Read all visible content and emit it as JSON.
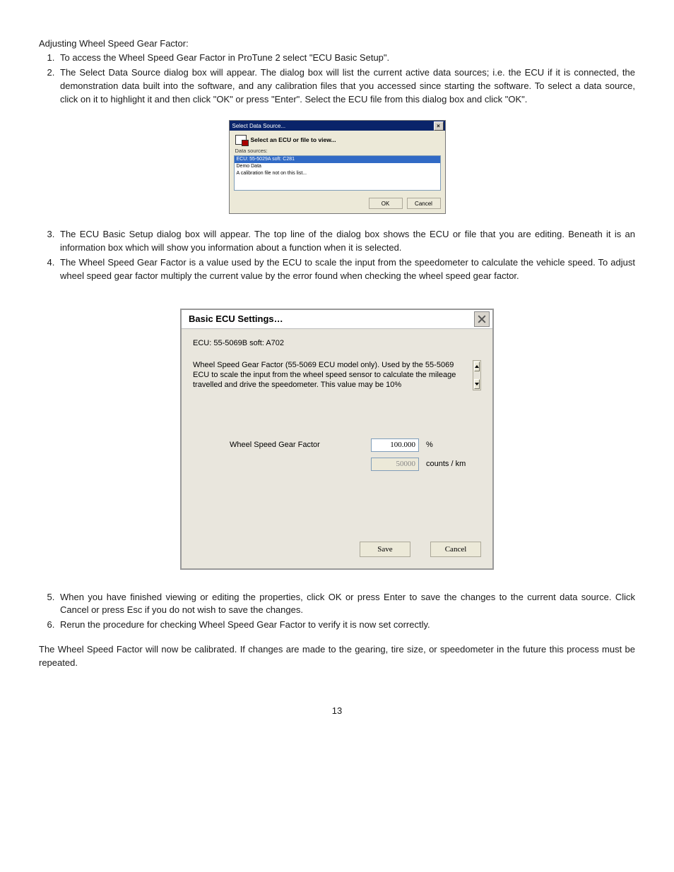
{
  "heading": "Adjusting Wheel Speed Gear Factor:",
  "steps_a": [
    "To access the Wheel Speed Gear Factor in ProTune 2 select \"ECU Basic Setup\".",
    "The Select Data Source dialog box will appear. The dialog box will list the current active data sources; i.e. the ECU if it is connected, the demonstration data built into the software, and any calibration files that you accessed since starting the software. To select a data source, click on it to highlight it and then click \"OK\" or press \"Enter\". Select the ECU file from this dialog box and click \"OK\"."
  ],
  "dlg1": {
    "peek": "",
    "title": "Select Data Source...",
    "prompt": "Select an ECU or file to view...",
    "list_label": "Data sources:",
    "items": [
      "ECU: 55-5029A soft: C281",
      "Demo Data",
      "A calibration file not on this list..."
    ],
    "ok": "OK",
    "cancel": "Cancel"
  },
  "steps_b": [
    "The ECU Basic Setup dialog box will appear. The top line of the dialog box shows the ECU or file that you are editing. Beneath it is an information box which will show you information about a function when it is selected.",
    "The Wheel Speed Gear Factor is a value used by the ECU to scale the input from the speedometer to calculate the vehicle speed. To adjust wheel speed gear factor multiply the current value by the error found when checking the wheel speed gear factor."
  ],
  "dlg2": {
    "title": "Basic ECU Settings…",
    "ecu_line": "ECU: 55-5069B soft: A702",
    "desc": "Wheel Speed Gear Factor (55-5069 ECU model only). Used by the 55-5069 ECU to scale the input from the wheel speed sensor to calculate the mileage travelled and drive the speedometer. This value may be 10%",
    "field_label": "Wheel Speed Gear Factor",
    "val1": "100.000",
    "unit1": "%",
    "val2": "50000",
    "unit2": "counts / km",
    "save": "Save",
    "cancel": "Cancel"
  },
  "steps_c": [
    "When you have finished viewing or editing the properties, click OK or press Enter to save the changes to the current data source. Click Cancel or press Esc if you do not wish to save the changes.",
    "Rerun the procedure for checking Wheel Speed Gear Factor to verify it is now set correctly."
  ],
  "closing": "The Wheel Speed Factor will now be calibrated. If changes are made to the gearing, tire size, or speedometer in the future this process must be repeated.",
  "page_no": "13"
}
